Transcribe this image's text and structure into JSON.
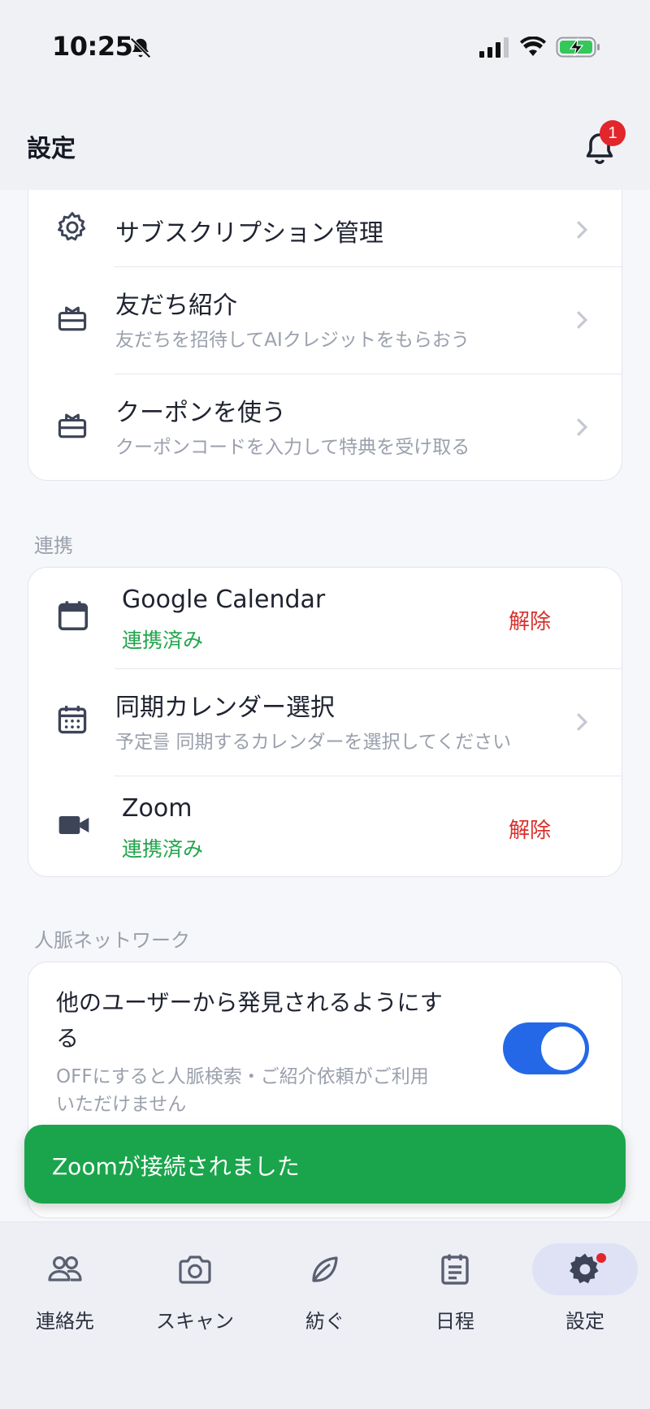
{
  "status_bar": {
    "time": "10:25"
  },
  "header": {
    "title": "設定",
    "notification_count": "1"
  },
  "account_rows": [
    {
      "title": "サブスクリプション管理",
      "subtitle": ""
    },
    {
      "title": "友だち紹介",
      "subtitle": "友だちを招待してAIクレジットをもらおう"
    },
    {
      "title": "クーポンを使う",
      "subtitle": "クーポンコードを入力して特典を受け取る"
    }
  ],
  "integrations": {
    "section_label": "連携",
    "google": {
      "title": "Google Calendar",
      "status": "連携済み",
      "action": "解除"
    },
    "sync": {
      "title": "同期カレンダー選択",
      "subtitle": "予定를 同期するカレンダーを選択してください"
    },
    "zoom": {
      "title": "Zoom",
      "status": "連携済み",
      "action": "解除"
    }
  },
  "network": {
    "section_label": "人脈ネットワーク",
    "discoverable_title_line1": "他のユーザーから発見されるようにす",
    "discoverable_title_line2": "る",
    "discoverable_desc_line1": "OFFにすると人脈検索・ご紹介依頼がご利用",
    "discoverable_desc_line2": "いただけません",
    "discoverable_enabled": true
  },
  "toast": {
    "message": "Zoomが接続されました"
  },
  "tabs": [
    {
      "label": "連絡先",
      "icon": "contacts-icon"
    },
    {
      "label": "スキャン",
      "icon": "camera-icon"
    },
    {
      "label": "紡ぐ",
      "icon": "leaf-icon"
    },
    {
      "label": "日程",
      "icon": "schedule-icon"
    },
    {
      "label": "設定",
      "icon": "gear-icon",
      "active": true
    }
  ],
  "colors": {
    "accent": "#2468e8",
    "success": "#1aa54c",
    "danger": "#d9302c",
    "badge": "#e2262b"
  }
}
